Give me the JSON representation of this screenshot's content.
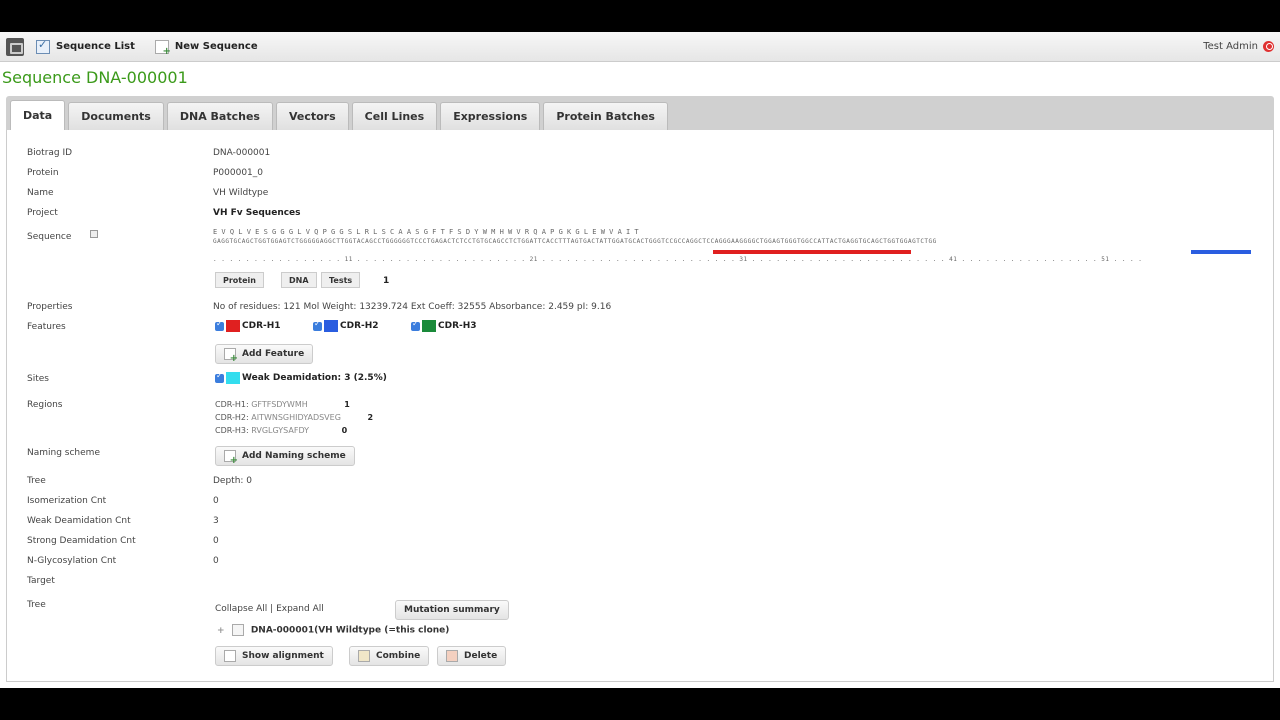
{
  "topbar": {
    "nav": [
      {
        "label": "Sequence List",
        "icon": "list-check-icon"
      },
      {
        "label": "New Sequence",
        "icon": "new-document-icon"
      }
    ],
    "user": "Test Admin"
  },
  "page_title": "Sequence DNA-000001",
  "tabs": [
    "Data",
    "Documents",
    "DNA Batches",
    "Vectors",
    "Cell Lines",
    "Expressions",
    "Protein Batches"
  ],
  "active_tab": "Data",
  "fields": {
    "biotrag_id": {
      "label": "Biotrag ID",
      "value": "DNA-000001"
    },
    "protein": {
      "label": "Protein",
      "value": "P000001_0"
    },
    "name": {
      "label": "Name",
      "value": "VH Wildtype"
    },
    "project": {
      "label": "Project",
      "value": "VH Fv Sequences"
    },
    "sequence": {
      "label": "Sequence"
    },
    "properties": {
      "label": "Properties",
      "value": "No of residues: 121    Mol Weight: 13239.724    Ext Coeff: 32555    Absorbance: 2.459    pI: 9.16"
    },
    "features": {
      "label": "Features"
    },
    "sites": {
      "label": "Sites"
    },
    "regions": {
      "label": "Regions"
    },
    "naming_scheme": {
      "label": "Naming scheme"
    },
    "tree": {
      "label": "Tree",
      "value": "Depth: 0"
    },
    "isomerization": {
      "label": "Isomerization Cnt",
      "value": "0"
    },
    "weak_deamidation": {
      "label": "Weak Deamidation Cnt",
      "value": "3"
    },
    "strong_deamidation": {
      "label": "Strong Deamidation Cnt",
      "value": "0"
    },
    "n_glycosylation": {
      "label": "N-Glycosylation Cnt",
      "value": "0"
    },
    "target": {
      "label": "Target",
      "value": ""
    },
    "tree2": {
      "label": "Tree"
    }
  },
  "sequence_view": {
    "aa_line": "E   V   Q   L   V   E   S   G   G   G   L   V   Q   P   G   G   S   L   R   L   S   C   A   A   S   G   F   T   F   S   D   Y   W   M   H   W   V   R   Q   A   P   G   K   G   L   E   W   V   A   I   T",
    "dna_line": "GAGGTGCAGCTGGTGGAGTCTGGGGGAGGCTTGGTACAGCCTGGGGGGTCCCTGAGACTCTCCTGTGCAGCCTCTGGATTCACCTTTAGTGACTATTGGATGCACTGGGTCCGCCAGGCTCCAGGGAAGGGGCTGGAGTGGGTGGCCATTACTGAGGTGCAGCTGGTGGAGTCTGG",
    "ruler": ". . . . . . . . . . . . . . . . 11 . . . . . . . . . . . . . . . . . . . . . 21 . . . . . . . . . . . . . . . . . . . . . . . . 31 . . . . . . . . . . . . . . . . . . . . . . . . 41 . . . . . . . . . . . . . . . . . 51 . . . .",
    "buttons": [
      "Protein",
      "DNA",
      "Tests"
    ],
    "count": "1"
  },
  "features": [
    {
      "label": "CDR-H1",
      "color": "#e02020"
    },
    {
      "label": "CDR-H2",
      "color": "#2a5de0"
    },
    {
      "label": "CDR-H3",
      "color": "#1a8a3a"
    }
  ],
  "add_feature_label": "Add Feature",
  "sites": {
    "label": "Weak Deamidation: 3 (2.5%)",
    "color": "#33ddee"
  },
  "regions": [
    {
      "name": "CDR-H1:",
      "seq": "GFTFSDYWMH",
      "count": "1"
    },
    {
      "name": "CDR-H2:",
      "seq": "AITWNSGHIDYADSVEG",
      "count": "2"
    },
    {
      "name": "CDR-H3:",
      "seq": "RVGLGYSAFDY",
      "count": "0"
    }
  ],
  "add_naming_label": "Add Naming scheme",
  "tree_controls": {
    "collapse": "Collapse All",
    "sep": "|",
    "expand": "Expand All",
    "mutation": "Mutation summary"
  },
  "tree_node": "DNA-000001(VH Wildtype (=this clone)",
  "actions": [
    "Show alignment",
    "Combine",
    "Delete"
  ],
  "colors": {
    "accent_green": "#3b9a1a",
    "cdr1": "#e02020",
    "cdr_blue": "#2a5de0"
  }
}
